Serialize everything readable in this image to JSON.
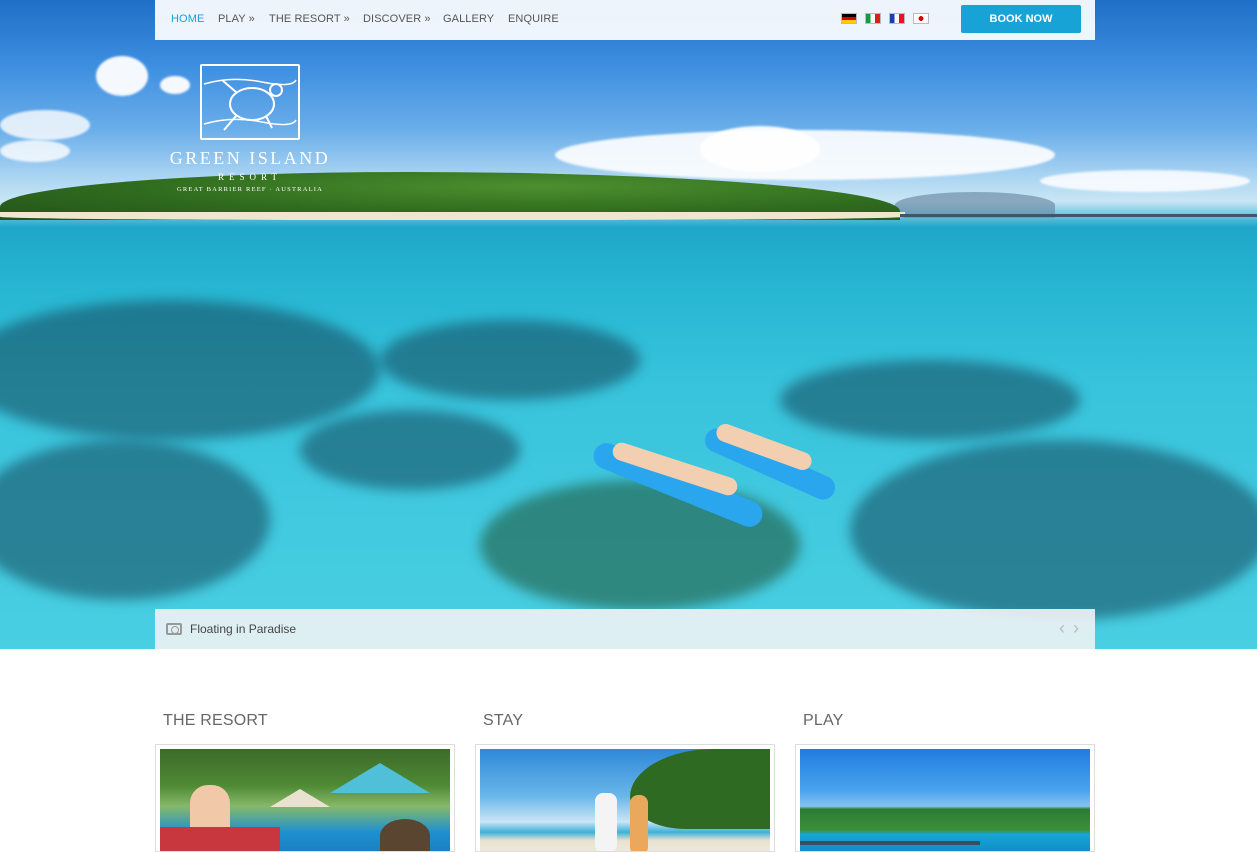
{
  "nav": {
    "items": [
      {
        "label": "HOME",
        "active": true
      },
      {
        "label": "PLAY »"
      },
      {
        "label": "THE RESORT »"
      },
      {
        "label": "DISCOVER »"
      },
      {
        "label": "GALLERY"
      },
      {
        "label": "ENQUIRE"
      }
    ],
    "flags": [
      "german-flag-icon",
      "italian-flag-icon",
      "french-flag-icon",
      "japanese-flag-icon"
    ],
    "book_now": "BOOK NOW"
  },
  "logo": {
    "title": "GREEN ISLAND",
    "subtitle": "RESORT",
    "tagline": "GREAT BARRIER REEF · AUSTRALIA"
  },
  "hero": {
    "caption": "Floating in Paradise"
  },
  "sections": [
    {
      "title": "THE RESORT"
    },
    {
      "title": "STAY"
    },
    {
      "title": "PLAY"
    }
  ],
  "colors": {
    "accent": "#17a3d6",
    "nav_text": "#555555",
    "section_title": "#666666"
  }
}
